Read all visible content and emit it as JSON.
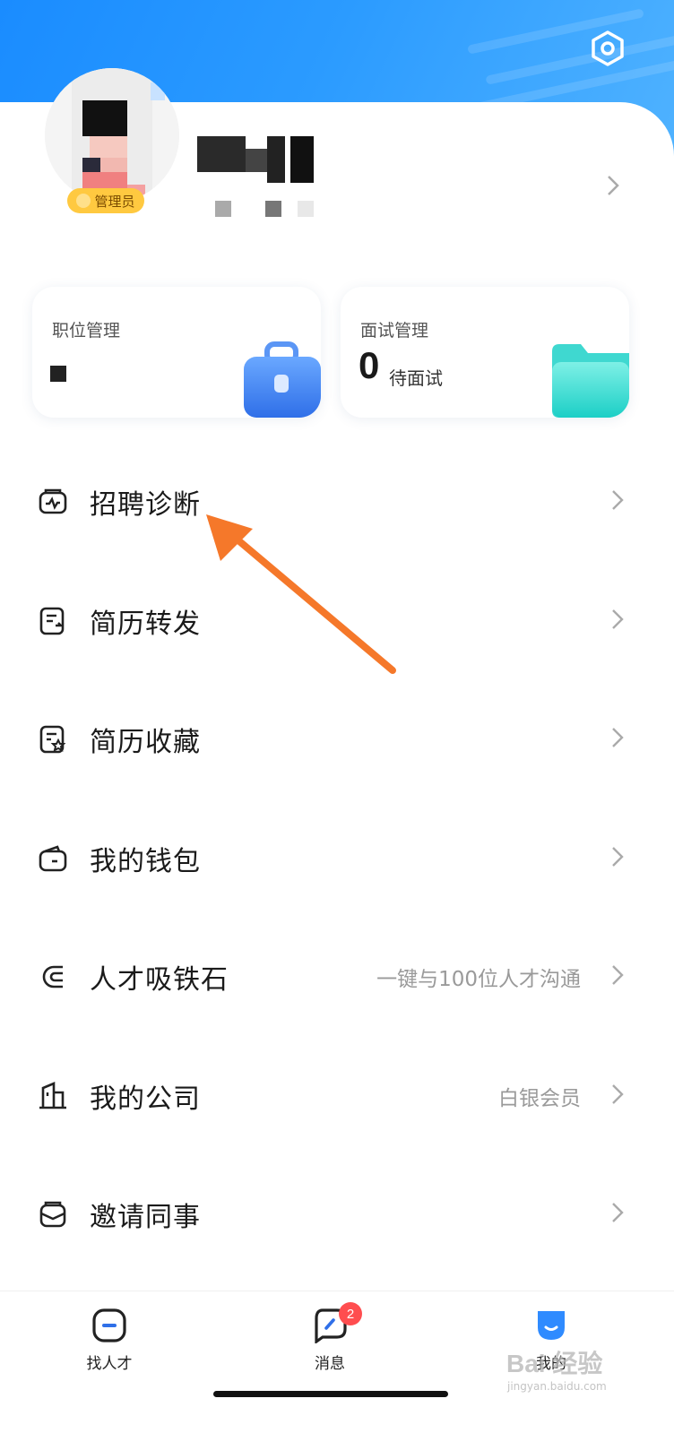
{
  "header": {
    "settings_icon": "hexagon-settings-icon",
    "gradient_colors": [
      "#1a8cff",
      "#52b4ff"
    ]
  },
  "profile": {
    "admin_badge": "管理员"
  },
  "stats": {
    "jobs": {
      "title": "职位管理"
    },
    "interviews": {
      "title": "面试管理",
      "count": "0",
      "count_label": "待面试"
    }
  },
  "menu": {
    "items": [
      {
        "label": "招聘诊断",
        "icon": "diagnosis-icon",
        "extra": ""
      },
      {
        "label": "简历转发",
        "icon": "resume-forward-icon",
        "extra": ""
      },
      {
        "label": "简历收藏",
        "icon": "resume-star-icon",
        "extra": ""
      },
      {
        "label": "我的钱包",
        "icon": "wallet-icon",
        "extra": ""
      },
      {
        "label": "人才吸铁石",
        "icon": "magnet-icon",
        "extra": "一键与100位人才沟通"
      },
      {
        "label": "我的公司",
        "icon": "company-icon",
        "extra": "白银会员"
      },
      {
        "label": "邀请同事",
        "icon": "invite-icon",
        "extra": ""
      }
    ]
  },
  "annotation": {
    "arrow_color": "#f5782a"
  },
  "bottom_nav": {
    "items": [
      {
        "label": "找人才",
        "icon": "find-talent-icon"
      },
      {
        "label": "消息",
        "icon": "message-icon",
        "badge": "2"
      },
      {
        "label": "我的",
        "icon": "me-icon"
      }
    ]
  },
  "watermark": {
    "text": "Bai 经验",
    "sub": "jingyan.baidu.com"
  }
}
